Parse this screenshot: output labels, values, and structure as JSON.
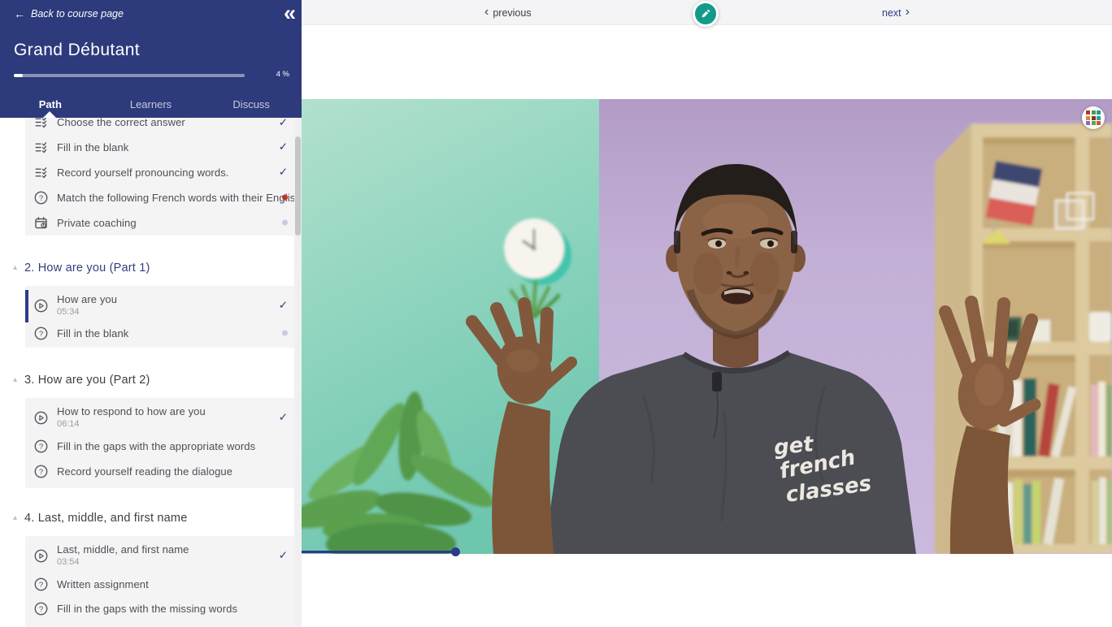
{
  "sidebar": {
    "back_label": "Back to course page",
    "course_title": "Grand Débutant",
    "progress_percent": 4,
    "progress_label": "4 %",
    "tabs": [
      {
        "label": "Path",
        "active": true
      },
      {
        "label": "Learners",
        "active": false
      },
      {
        "label": "Discuss",
        "active": false
      }
    ],
    "sections": [
      {
        "title": "",
        "items": [
          {
            "label": "Choose the correct answer",
            "icon": "quiz",
            "status": "done"
          },
          {
            "label": "Fill in the blank",
            "icon": "quiz",
            "status": "done"
          },
          {
            "label": "Record yourself pronouncing words.",
            "icon": "quiz",
            "status": "done"
          },
          {
            "label": "Match the following French words with their Englis…",
            "icon": "question",
            "status": "failed"
          },
          {
            "label": "Private coaching",
            "icon": "calendar",
            "status": "not-started"
          }
        ]
      },
      {
        "title": "2. How are you (Part 1)",
        "items": [
          {
            "label": "How are you",
            "duration": "05:34",
            "icon": "video",
            "status": "done",
            "current": true
          },
          {
            "label": "Fill in the blank",
            "icon": "question",
            "status": "not-started"
          }
        ]
      },
      {
        "title": "3. How are you (Part 2)",
        "items": [
          {
            "label": "How to respond to how are you",
            "duration": "06:14",
            "icon": "video",
            "status": "done"
          },
          {
            "label": "Fill in the gaps with the appropriate words",
            "icon": "question",
            "status": "none"
          },
          {
            "label": "Record yourself reading the dialogue",
            "icon": "question",
            "status": "none"
          }
        ]
      },
      {
        "title": "4. Last, middle, and first name",
        "items": [
          {
            "label": "Last, middle, and first name",
            "duration": "03:54",
            "icon": "video",
            "status": "done"
          },
          {
            "label": "Written assignment",
            "icon": "question",
            "status": "none"
          },
          {
            "label": "Fill in the gaps with the missing words",
            "icon": "question",
            "status": "none"
          }
        ]
      }
    ]
  },
  "topbar": {
    "previous_label": "previous",
    "next_label": "next"
  },
  "video": {
    "tshirt_logo": [
      "get",
      "french",
      "classes"
    ],
    "progress_percent": 19
  },
  "icons": {
    "back_arrow": "←",
    "collapse_sidebar": "«",
    "chev_left": "‹",
    "chev_right": "›",
    "section_collapse": "▴",
    "check": "✓",
    "question_mark": "?"
  },
  "colors": {
    "sidebar_navy": "#2d3a7c",
    "accent_blue": "#2c3a8e",
    "pencil_teal": "#149a8b",
    "status_done": "#2d3a7c",
    "status_failed": "#c6302c",
    "status_pending": "#c7cce0"
  }
}
